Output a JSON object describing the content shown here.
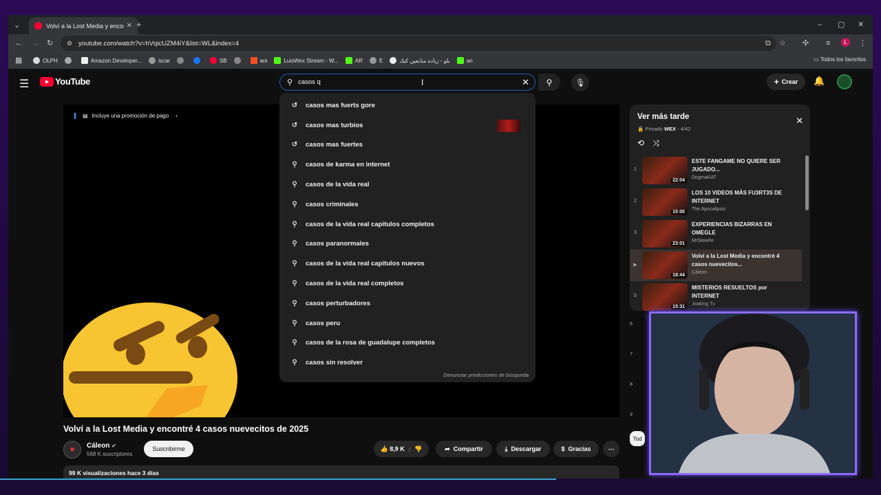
{
  "browser": {
    "tab_title": "Volví a la Lost Media y encontré",
    "url": "youtube.com/watch?v=hVqicUZM4iY&list=WL&index=4",
    "bookmarks": [
      "OLPH",
      "Amazon Developer...",
      "iscar",
      "SB",
      "ani",
      "LuisWex Stream - W...",
      "AR",
      "E",
      "بلو - زياده متابعين كيك",
      "an"
    ],
    "bookmarks_all": "Todos los favoritos"
  },
  "youtube": {
    "logo": "YouTube",
    "search_value": "casos q",
    "create_label": "Crear",
    "promo": "Incluye una promoción de pago",
    "suggestions": [
      {
        "text": "casos mas fuerts gore",
        "icon": "history-icon"
      },
      {
        "text": "casos mas turbios",
        "icon": "history-icon"
      },
      {
        "text": "casos mas fuertes",
        "icon": "history-icon"
      },
      {
        "text": "casos de karma en internet",
        "icon": "search-icon"
      },
      {
        "text": "casos de la vida real",
        "icon": "search-icon"
      },
      {
        "text": "casos criminales",
        "icon": "search-icon"
      },
      {
        "text": "casos de la vida real capitulos completos",
        "icon": "search-icon"
      },
      {
        "text": "casos paranormales",
        "icon": "search-icon"
      },
      {
        "text": "casos de la vida real capitulos nuevos",
        "icon": "search-icon"
      },
      {
        "text": "casos de la vida real completos",
        "icon": "search-icon"
      },
      {
        "text": "casos perturbadores",
        "icon": "search-icon"
      },
      {
        "text": "casos peru",
        "icon": "search-icon"
      },
      {
        "text": "casos de la rosa de guadalupe completos",
        "icon": "search-icon"
      },
      {
        "text": "casos sin resolver",
        "icon": "search-icon"
      }
    ],
    "report_text": "Denunciar predicciones de búsqueda",
    "video": {
      "title": "Volví a la Lost Media y encontré 4 casos nuevecitos de 2025",
      "channel": "Cáleon",
      "subscribers": "568 K suscriptores",
      "subscribe_label": "Suscribirme",
      "likes": "8,9 K",
      "share_label": "Compartir",
      "download_label": "Descargar",
      "thanks_label": "Gracias",
      "views": "99 K visualizaciones hace 3 días"
    },
    "playlist": {
      "title": "Ver más tarde",
      "privacy": "Privado",
      "owner": "WEX",
      "position": "4/42",
      "items": [
        {
          "num": "1",
          "title": "ESTE FANGAME NO QUIERE SER JUGADO...",
          "channel": "DogmaKAT",
          "duration": "22:04"
        },
        {
          "num": "2",
          "title": "LOS 10 VIDEOS MÁS FU3RT3S DE INTERNET",
          "channel": "The Apocalipsis",
          "duration": "15:00"
        },
        {
          "num": "3",
          "title": "EXPERIENCIAS BIZARRAS EN OMEGLE",
          "channel": "MrSlowPe",
          "duration": "23:01"
        },
        {
          "num": "▶",
          "title": "Volví a la Lost Media y encontré 4 casos nuevecitos...",
          "channel": "Cáleon",
          "duration": "18:44"
        },
        {
          "num": "5",
          "title": "MISTERIOS RESUELTOS por INTERNET",
          "channel": "Joaking Tv",
          "duration": "15:31"
        }
      ],
      "more_nums": [
        "6",
        "7",
        "8",
        "9"
      ]
    },
    "chip_label": "Tod"
  }
}
